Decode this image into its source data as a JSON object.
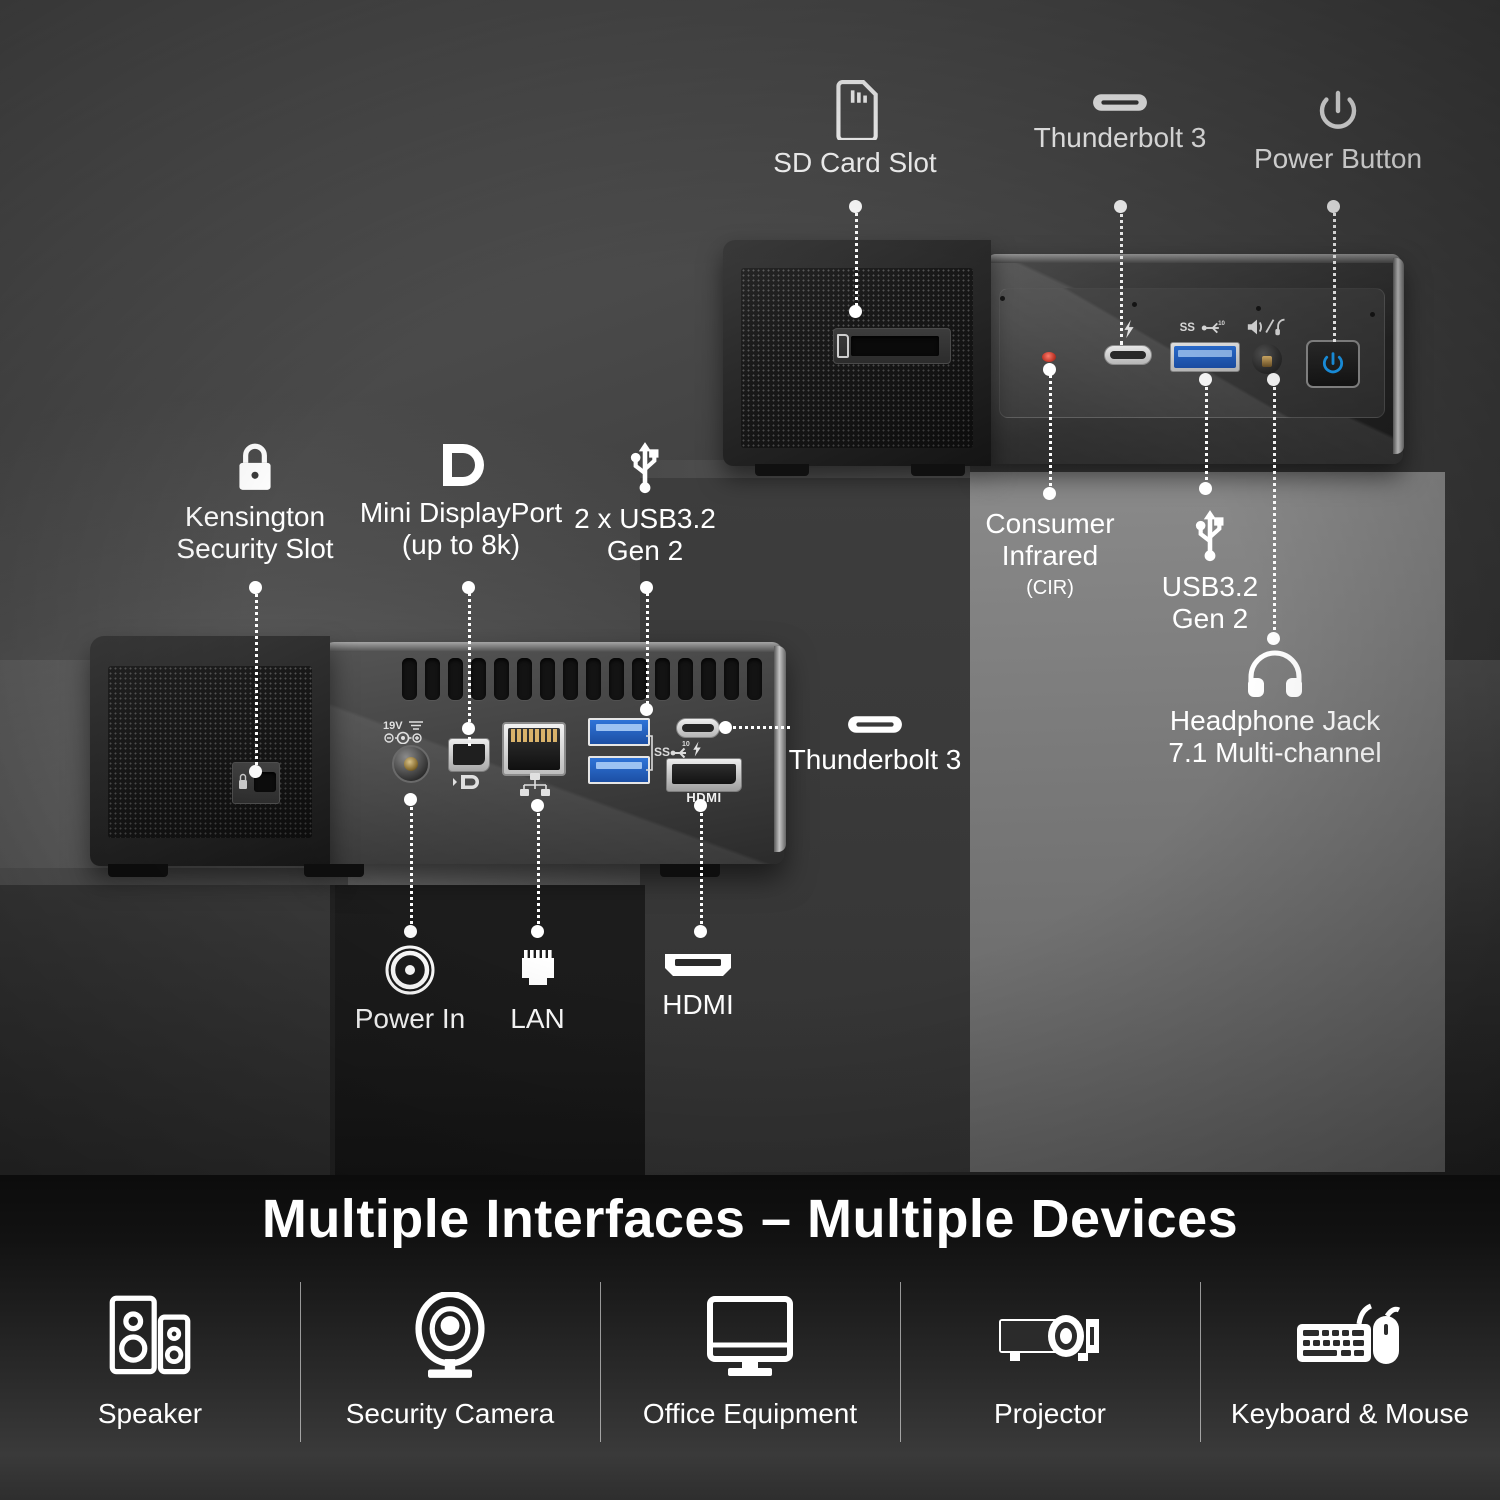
{
  "product": {
    "device_name": "mini-pc",
    "units": 2
  },
  "callouts": {
    "sd_card": {
      "label": "SD Card Slot",
      "icon": "sd-card-icon"
    },
    "thunderbolt_top": {
      "label": "Thunderbolt 3",
      "icon": "usb-c-port-icon"
    },
    "power_button": {
      "label": "Power Button",
      "icon": "power-icon"
    },
    "kensington": {
      "line1": "Kensington",
      "line2": "Security Slot",
      "icon": "padlock-icon"
    },
    "mini_dp": {
      "line1": "Mini DisplayPort",
      "line2": "(up to 8k)",
      "icon": "displayport-icon"
    },
    "usb_rear": {
      "line1": "2 x USB3.2",
      "line2": "Gen 2",
      "icon": "usb-icon"
    },
    "thunderbolt_rear": {
      "label": "Thunderbolt 3",
      "icon": "usb-c-port-icon"
    },
    "consumer_ir": {
      "line1": "Consumer",
      "line2": "Infrared",
      "line3": "(CIR)"
    },
    "usb_front": {
      "line1": "USB3.2",
      "line2": "Gen 2",
      "icon": "usb-icon"
    },
    "headphone": {
      "line1": "Headphone Jack",
      "line2": "7.1 Multi-channel",
      "icon": "headphones-icon"
    },
    "power_in": {
      "label": "Power In",
      "icon": "dc-jack-icon"
    },
    "lan": {
      "label": "LAN",
      "icon": "rj45-icon"
    },
    "hdmi": {
      "label": "HDMI",
      "icon": "hdmi-icon"
    }
  },
  "port_markings": {
    "dc_voltage": "19V",
    "hdmi_text": "HDMI"
  },
  "banner": {
    "headline": "Multiple Interfaces – Multiple Devices",
    "devices": [
      {
        "label": "Speaker",
        "icon": "speaker-icon"
      },
      {
        "label": "Security Camera",
        "icon": "security-camera-icon"
      },
      {
        "label": "Office Equipment",
        "icon": "monitor-icon"
      },
      {
        "label": "Projector",
        "icon": "projector-icon"
      },
      {
        "label": "Keyboard & Mouse",
        "icon": "keyboard-mouse-icon"
      }
    ]
  },
  "colors": {
    "accent_blue": "#2f74d8",
    "power_led_blue": "#1b9bf0",
    "ir_red": "#c0392b",
    "text": "#ffffff",
    "banner_bg": "#121212"
  }
}
